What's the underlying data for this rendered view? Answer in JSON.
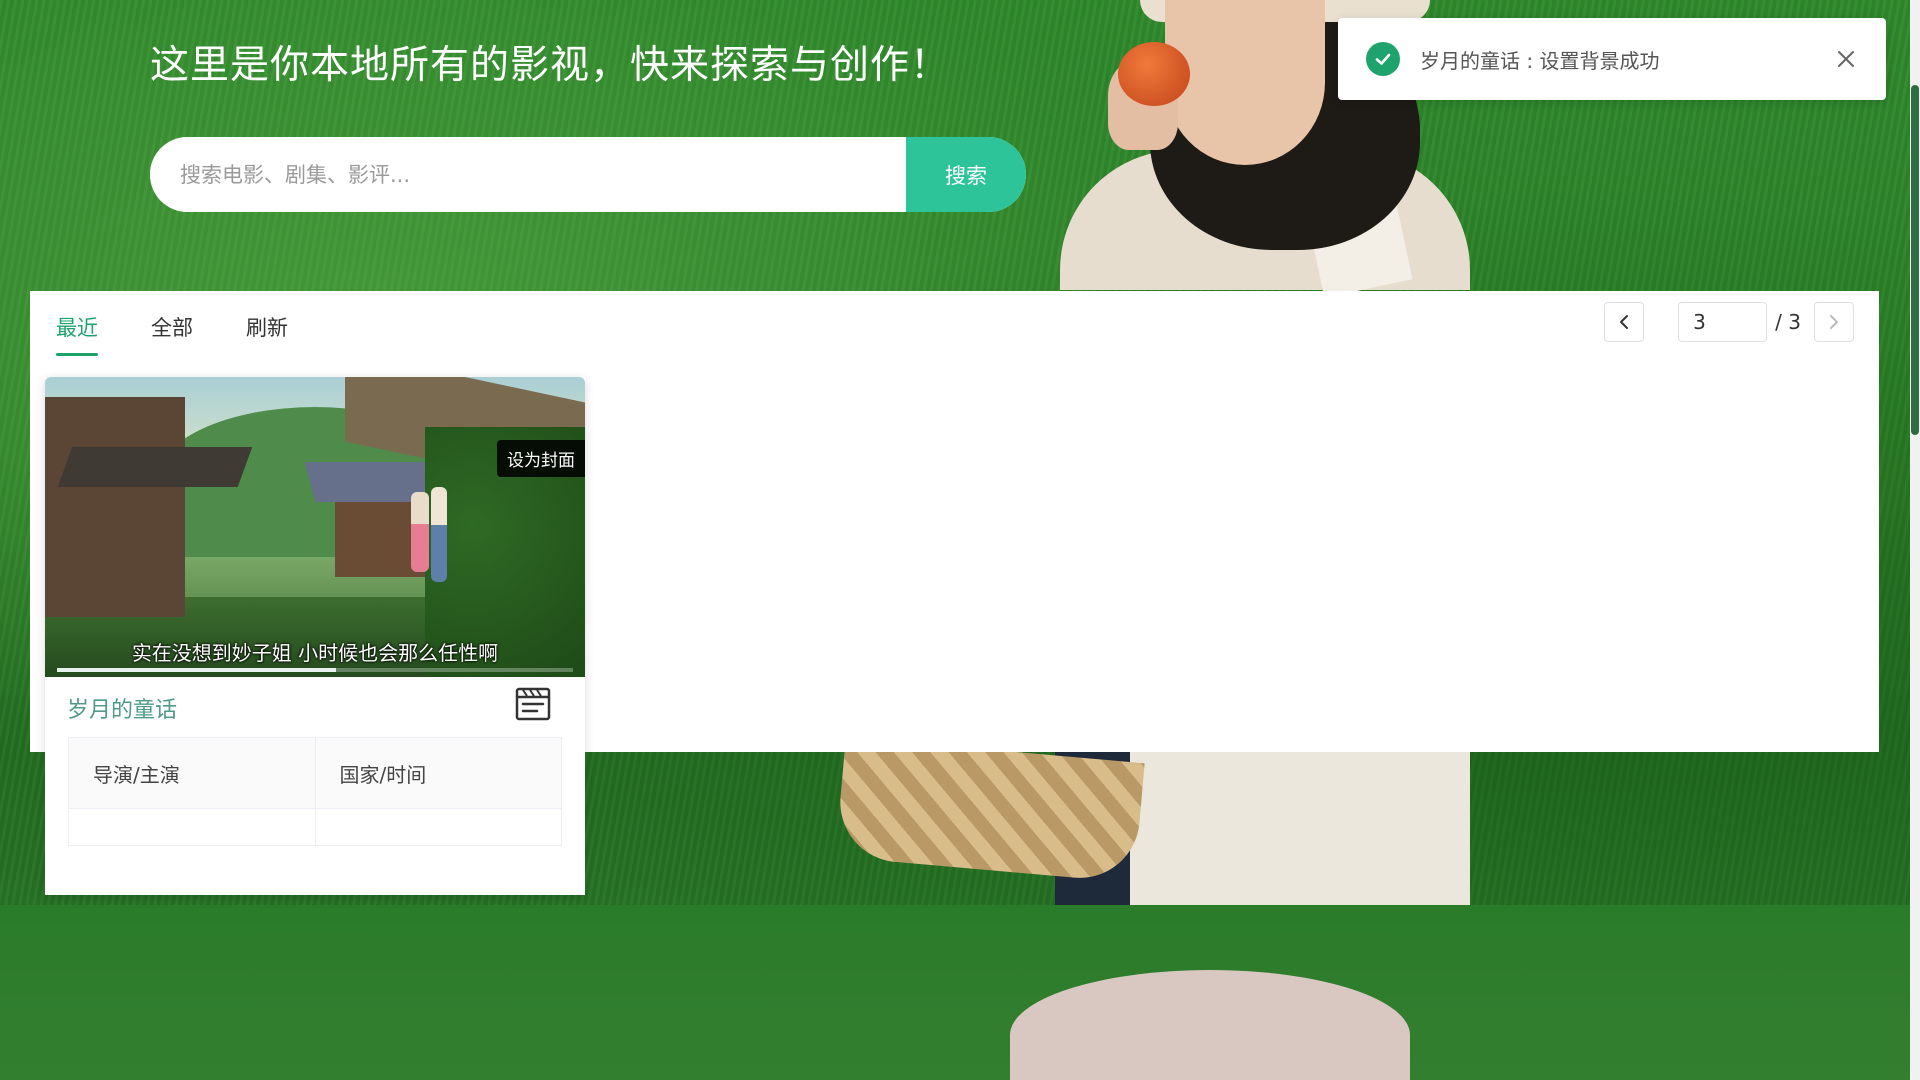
{
  "header": {
    "headline": "这里是你本地所有的影视，快来探索与创作！"
  },
  "search": {
    "placeholder": "搜索电影、剧集、影评...",
    "value": "",
    "button_label": "搜索"
  },
  "toast": {
    "message": "岁月的童话 : 设置背景成功",
    "icon": "check-circle-icon",
    "close_icon": "close-icon"
  },
  "tabs": [
    {
      "label": "最近",
      "active": true
    },
    {
      "label": "全部",
      "active": false
    },
    {
      "label": "刷新",
      "active": false
    }
  ],
  "pagination": {
    "current": "3",
    "total_label": "/ 3"
  },
  "card": {
    "set_cover_label": "设为封面",
    "subtitle": "实在没想到妙子姐  小时候也会那么任性啊",
    "progress": 0.54,
    "title": "岁月的童话",
    "title_icon": "clapperboard-icon",
    "table_headers": [
      "导演/主演",
      "国家/时间"
    ],
    "table_rows": [
      [
        "",
        ""
      ]
    ]
  },
  "colors": {
    "accent": "#1fa36c",
    "search_button": "#2ec49a",
    "card_title": "#4f9a89",
    "background_green": "#2a7a2a"
  }
}
